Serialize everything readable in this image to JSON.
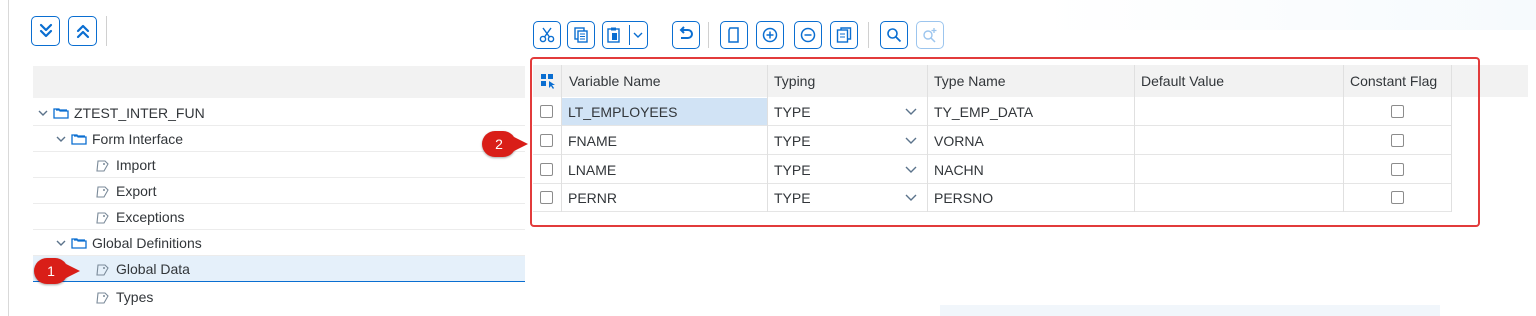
{
  "left_toolbar": {
    "expand_all_icon": "double-chevron-down-icon",
    "collapse_all_icon": "double-chevron-up-icon"
  },
  "tree": {
    "items": [
      {
        "label": "ZTEST_INTER_FUN",
        "icon": "folder-icon",
        "expanded": true
      },
      {
        "label": "Form Interface",
        "icon": "folder-icon",
        "expanded": true
      },
      {
        "label": "Import",
        "icon": "node-icon"
      },
      {
        "label": "Export",
        "icon": "node-icon"
      },
      {
        "label": "Exceptions",
        "icon": "node-icon"
      },
      {
        "label": "Global Definitions",
        "icon": "folder-icon",
        "expanded": true
      },
      {
        "label": "Global Data",
        "icon": "node-icon",
        "selected": true
      },
      {
        "label": "Types",
        "icon": "node-icon"
      }
    ]
  },
  "right_toolbar": {
    "buttons": [
      "cut-icon",
      "copy-icon",
      "paste-icon",
      "undo-icon",
      "new-row-icon",
      "insert-row-icon",
      "delete-row-icon",
      "copy-row-icon",
      "find-icon",
      "find-next-icon"
    ]
  },
  "table": {
    "columns": [
      "Variable Name",
      "Typing",
      "Type Name",
      "Default Value",
      "Constant Flag"
    ],
    "rows": [
      {
        "variable": "LT_EMPLOYEES",
        "typing": "TYPE",
        "type_name": "TY_EMP_DATA",
        "default": "",
        "constant": false
      },
      {
        "variable": "FNAME",
        "typing": "TYPE",
        "type_name": "VORNA",
        "default": "",
        "constant": false
      },
      {
        "variable": "LNAME",
        "typing": "TYPE",
        "type_name": "NACHN",
        "default": "",
        "constant": false
      },
      {
        "variable": "PERNR",
        "typing": "TYPE",
        "type_name": "PERSNO",
        "default": "",
        "constant": false
      }
    ]
  },
  "callouts": {
    "one": "1",
    "two": "2"
  },
  "colors": {
    "accent": "#0a6ed1",
    "callout": "#d91e18",
    "selection": "#e5f0fa"
  }
}
